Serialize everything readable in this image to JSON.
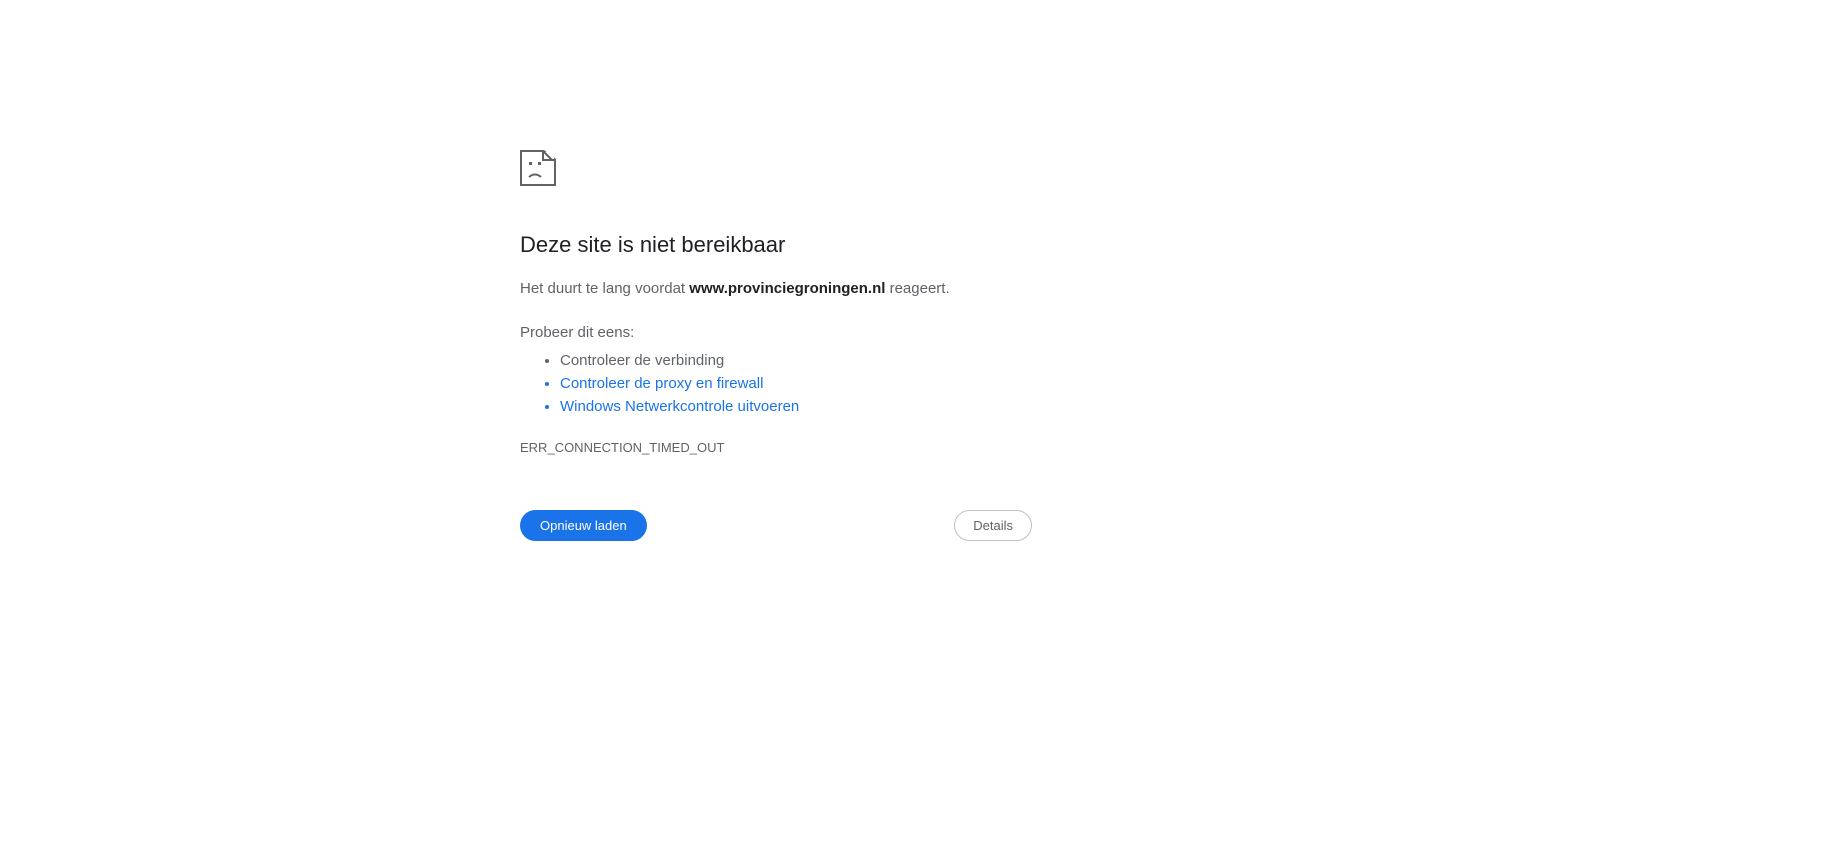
{
  "error": {
    "title": "Deze site is niet bereikbaar",
    "message_prefix": "Het duurt te lang voordat ",
    "message_domain": "www.provinciegroningen.nl",
    "message_suffix": " reageert.",
    "suggestions_title": "Probeer dit eens:",
    "suggestions": [
      {
        "text": "Controleer de verbinding",
        "is_link": false
      },
      {
        "text": "Controleer de proxy en firewall",
        "is_link": true
      },
      {
        "text": "Windows Netwerkcontrole uitvoeren",
        "is_link": true
      }
    ],
    "error_code": "ERR_CONNECTION_TIMED_OUT"
  },
  "buttons": {
    "reload_label": "Opnieuw laden",
    "details_label": "Details"
  }
}
